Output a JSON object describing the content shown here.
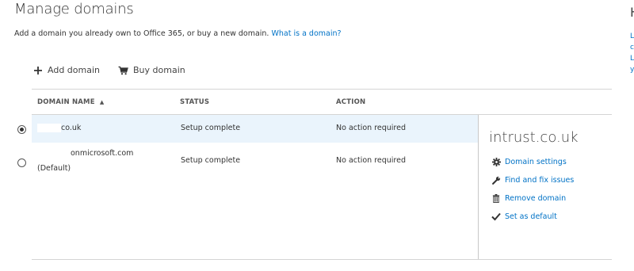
{
  "page": {
    "title": "Manage domains",
    "intro_text": "Add a domain you already own to Office 365, or buy a new domain.",
    "intro_link": "What is a domain?"
  },
  "toolbar": {
    "add_icon": "plus-icon",
    "add_label": "Add domain",
    "buy_icon": "cart-icon",
    "buy_label": "Buy domain"
  },
  "table": {
    "columns": [
      "DOMAIN NAME",
      "STATUS",
      "ACTION"
    ],
    "sort_indicator": "▲",
    "rows": [
      {
        "selected": true,
        "domain": "co.uk",
        "domain_sub": "",
        "status": "Setup complete",
        "action": "No action required"
      },
      {
        "selected": false,
        "domain": "onmicrosoft.com",
        "domain_sub": "(Default)",
        "status": "Setup complete",
        "action": "No action required"
      }
    ]
  },
  "details_panel": {
    "title": "intrust.co.uk",
    "actions": [
      {
        "icon": "gear-icon",
        "label": "Domain settings"
      },
      {
        "icon": "wrench-icon",
        "label": "Find and fix issues"
      },
      {
        "icon": "trash-icon",
        "label": "Remove domain"
      },
      {
        "icon": "checkmark-icon",
        "label": "Set as default"
      }
    ]
  },
  "right_edge": {
    "title_fragment": "H",
    "link_fragments": [
      "L",
      "c",
      "L",
      "y"
    ]
  },
  "colors": {
    "link": "#0072c6",
    "selected_row": "#eaf4fc",
    "divider": "#d4d4d4"
  }
}
